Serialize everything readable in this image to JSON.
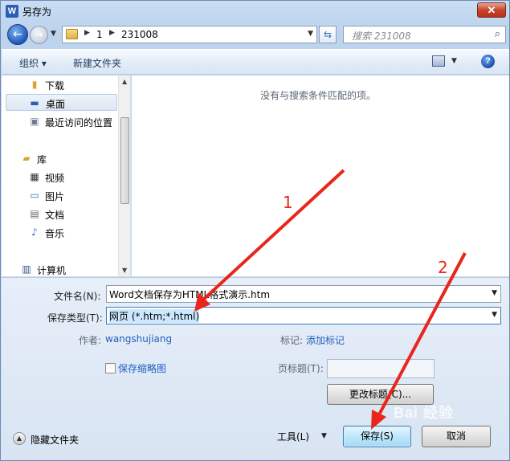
{
  "window": {
    "title": "另存为",
    "app_icon_letter": "W",
    "close_glyph": "✕"
  },
  "address": {
    "segments": [
      "1",
      "231008"
    ],
    "search_placeholder": "搜索 231008"
  },
  "toolbar": {
    "organize": "组织 ▾",
    "new_folder": "新建文件夹",
    "help": "?"
  },
  "nav": {
    "items": [
      {
        "label": "下载",
        "icon": "download-folder-icon"
      },
      {
        "label": "桌面",
        "icon": "desktop-icon",
        "selected": true
      },
      {
        "label": "最近访问的位置",
        "icon": "recent-places-icon"
      },
      {
        "label": "库",
        "icon": "library-icon"
      },
      {
        "label": "视频",
        "icon": "videos-icon"
      },
      {
        "label": "图片",
        "icon": "pictures-icon"
      },
      {
        "label": "文档",
        "icon": "documents-icon"
      },
      {
        "label": "音乐",
        "icon": "music-icon"
      },
      {
        "label": "计算机",
        "icon": "computer-icon"
      }
    ]
  },
  "files": {
    "empty_message": "没有与搜索条件匹配的项。"
  },
  "form": {
    "filename_label": "文件名(N):",
    "filename_value": "Word文档保存为HTML格式演示.htm",
    "filetype_label": "保存类型(T):",
    "filetype_value": "网页 (*.htm;*.html)",
    "author_label": "作者:",
    "author_value": "wangshujiang",
    "tags_label": "标记:",
    "tags_value": "添加标记",
    "thumbnail_label": "保存缩略图",
    "page_title_label": "页标题(T):",
    "page_title_value": "",
    "change_title_button": "更改标题(C)...",
    "hide_folders": "隐藏文件夹",
    "tools": "工具(L)",
    "save_button": "保存(S)",
    "cancel_button": "取消"
  },
  "annotations": {
    "marker1": "1",
    "marker2": "2",
    "arrow_color": "#e8261c",
    "watermark": "Bai 经验"
  },
  "colors": {
    "accent": "#3c7fb1",
    "link": "#1f5fbf",
    "selection": "#cce8ff"
  }
}
